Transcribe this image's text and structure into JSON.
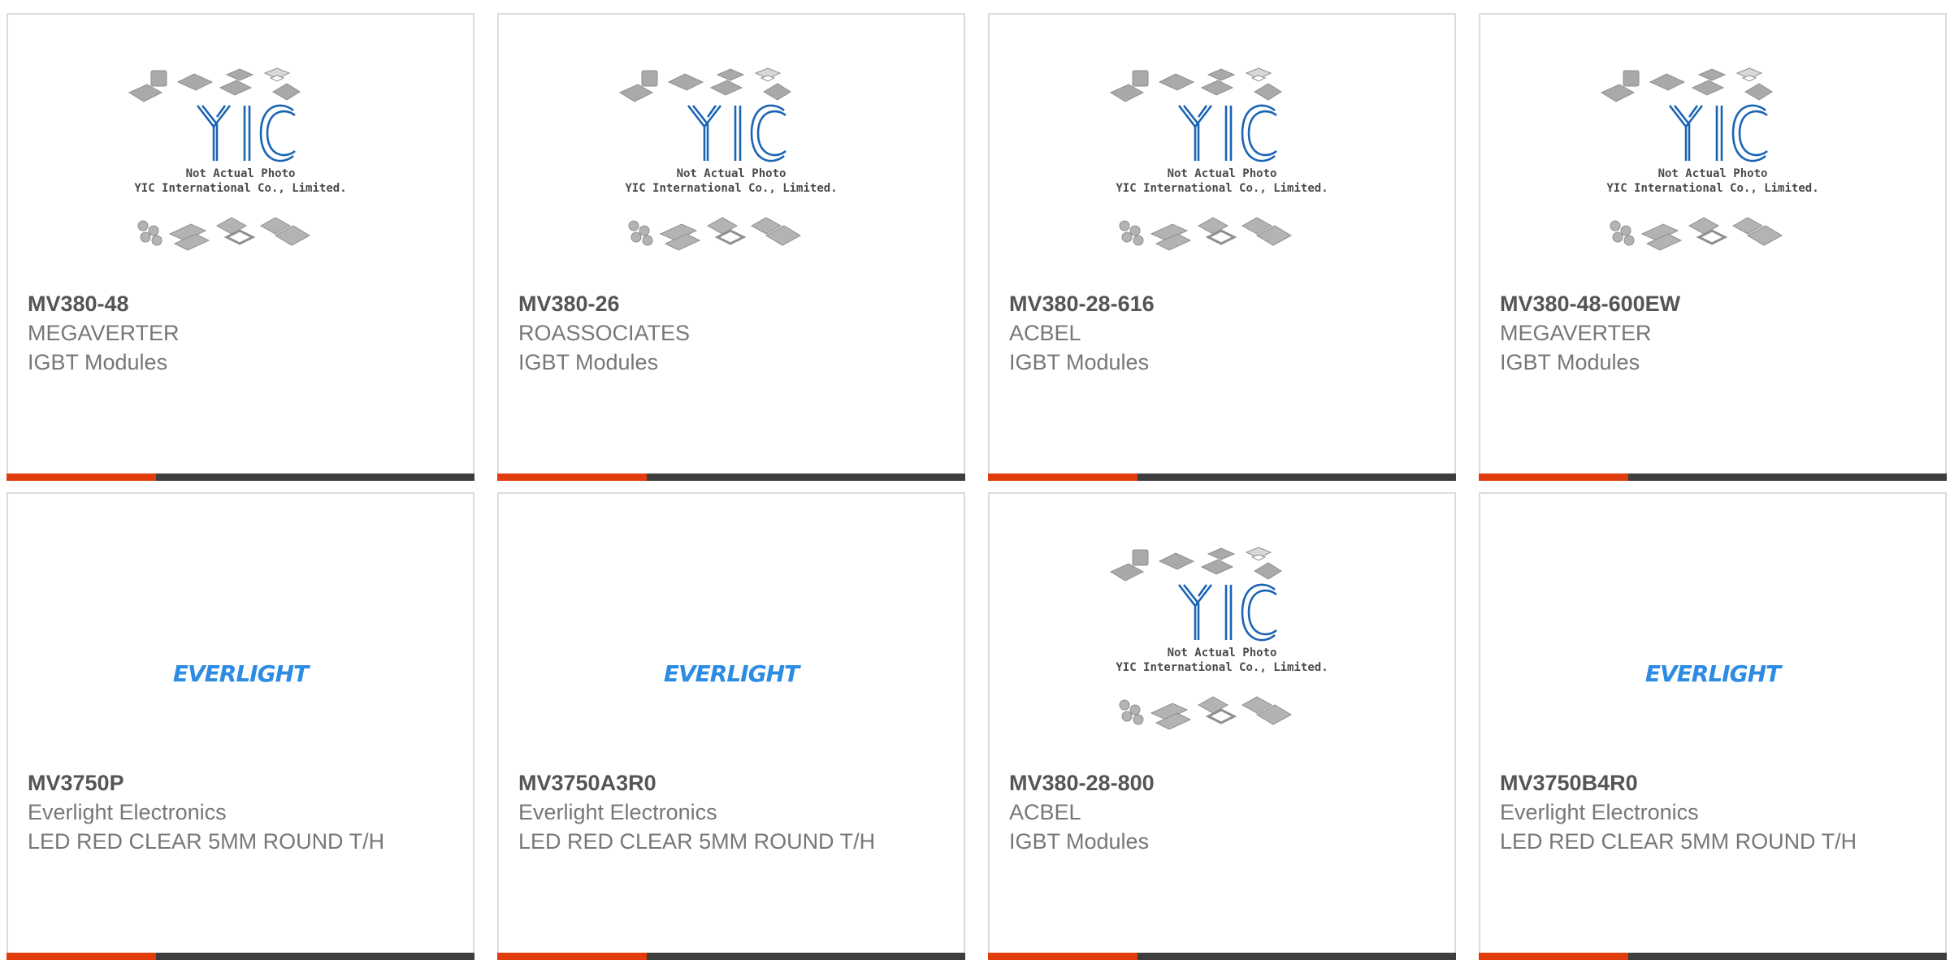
{
  "colors": {
    "accent": "#e13c0c",
    "bar": "#3e3e3e",
    "yic_blue": "#1a64b4",
    "everlight_blue": "#2c8be2"
  },
  "placeholder": {
    "line1": "Not Actual Photo",
    "line2": "YIC International Co., Limited.",
    "brand": "YIC"
  },
  "everlight_logo": "EVERLIGHT",
  "products": [
    {
      "part": "MV380-48",
      "maker": "MEGAVERTER",
      "desc": "IGBT Modules",
      "image": "yic-placeholder"
    },
    {
      "part": "MV380-26",
      "maker": "ROASSOCIATES",
      "desc": "IGBT Modules",
      "image": "yic-placeholder"
    },
    {
      "part": "MV380-28-616",
      "maker": "ACBEL",
      "desc": "IGBT Modules",
      "image": "yic-placeholder"
    },
    {
      "part": "MV380-48-600EW",
      "maker": "MEGAVERTER",
      "desc": "IGBT Modules",
      "image": "yic-placeholder"
    },
    {
      "part": "MV3750P",
      "maker": "Everlight Electronics",
      "desc": "LED RED CLEAR 5MM ROUND T/H",
      "image": "everlight-logo"
    },
    {
      "part": "MV3750A3R0",
      "maker": "Everlight Electronics",
      "desc": "LED RED CLEAR 5MM ROUND T/H",
      "image": "everlight-logo"
    },
    {
      "part": "MV380-28-800",
      "maker": "ACBEL",
      "desc": "IGBT Modules",
      "image": "yic-placeholder"
    },
    {
      "part": "MV3750B4R0",
      "maker": "Everlight Electronics",
      "desc": "LED RED CLEAR 5MM ROUND T/H",
      "image": "everlight-logo"
    }
  ]
}
